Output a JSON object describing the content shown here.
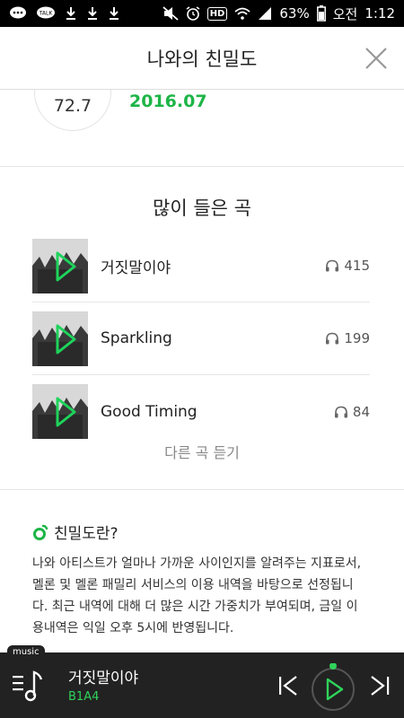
{
  "status_bar": {
    "battery_percent": "63%",
    "time_period": "오전",
    "time": "1:12",
    "icons": [
      "chat-bubble-icon",
      "talk-icon",
      "download-icon",
      "download-icon",
      "download-icon",
      "mute-icon",
      "alarm-icon",
      "hd-icon",
      "wifi-icon",
      "signal-icon",
      "battery-icon"
    ],
    "hd_label": "HD",
    "talk_label": "TALK"
  },
  "header": {
    "title": "나와의 친밀도",
    "close_icon": "close-icon"
  },
  "score": {
    "value": "72.7",
    "date": "2016.07",
    "accent_color": "#1db547"
  },
  "top_songs": {
    "heading": "많이 들은 곡",
    "count_icon": "headphones-icon",
    "items": [
      {
        "title": "거짓말이야",
        "count": "415"
      },
      {
        "title": "Sparkling",
        "count": "199"
      },
      {
        "title": "Good Timing",
        "count": "84"
      }
    ],
    "more_label": "다른 곡 듣기"
  },
  "intimacy_info": {
    "title": "친밀도란?",
    "body": "나와 아티스트가 얼마나 가까운 사이인지를 알려주는 지표로서, 멜론 및 멜론 패밀리 서비스의 이용 내역을 바탕으로 선정됩니다. 최근 내역에 대해 더 많은 시간 가중치가 부여되며, 금일 이용내역은 익일 오후 5시에 반영됩니다."
  },
  "player": {
    "tab_label": "music",
    "title": "거짓말이야",
    "artist": "B1A4",
    "accent_color": "#2fd35b"
  }
}
